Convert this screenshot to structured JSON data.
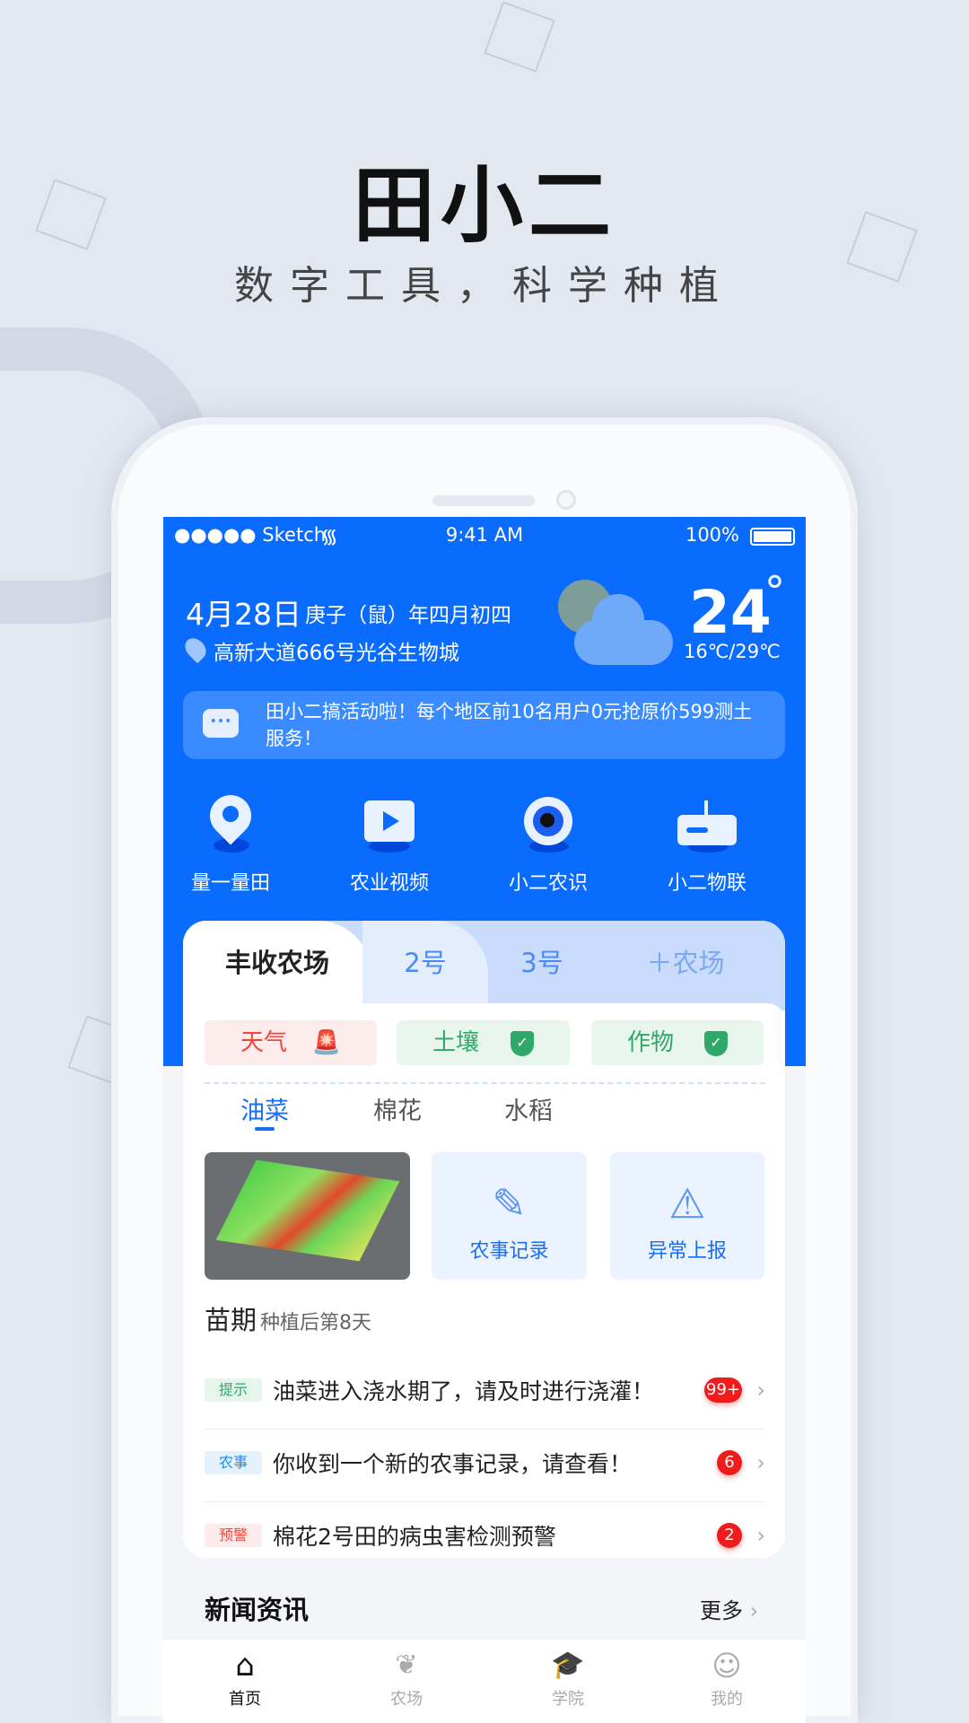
{
  "promo": {
    "title": "田小二",
    "subtitle": "数字工具，科学种植"
  },
  "status_bar": {
    "carrier": "●●●●● Sketch",
    "time": "9:41 AM",
    "battery": "100%"
  },
  "header": {
    "date": "4月28日",
    "lunar": "庚子（鼠）年四月初四",
    "address": "高新大道666号光谷生物城",
    "temperature": "24",
    "degree": "°",
    "range": "16℃/29℃",
    "weather_icon": "partly-cloudy-icon"
  },
  "notice": {
    "text": "田小二搞活动啦！每个地区前10名用户0元抢原价599测土服务！"
  },
  "quick_actions": [
    {
      "label": "量一量田",
      "icon": "location-pin-icon"
    },
    {
      "label": "农业视频",
      "icon": "video-play-icon"
    },
    {
      "label": "小二农识",
      "icon": "eye-icon"
    },
    {
      "label": "小二物联",
      "icon": "router-icon"
    }
  ],
  "farm_tabs": [
    {
      "label": "丰收农场",
      "active": true
    },
    {
      "label": "2号"
    },
    {
      "label": "3号"
    },
    {
      "label": "＋农场"
    }
  ],
  "chips": [
    {
      "label": "天气",
      "icon": "alarm-light-icon",
      "color": "#f0453a"
    },
    {
      "label": "土壤",
      "icon": "shield-check-icon",
      "color": "#2fa86a"
    },
    {
      "label": "作物",
      "icon": "shield-check-icon",
      "color": "#2fa86a"
    }
  ],
  "crop_tabs": [
    {
      "label": "油菜",
      "active": true
    },
    {
      "label": "棉花"
    },
    {
      "label": "水稻"
    }
  ],
  "tiles": [
    {
      "label": "农事记录",
      "icon": "pencil-icon"
    },
    {
      "label": "异常上报",
      "icon": "warning-icon"
    }
  ],
  "stage": {
    "name": "苗期",
    "detail": "种植后第8天"
  },
  "messages": [
    {
      "tag": "提示",
      "text": "油菜进入浇水期了，请及时进行浇灌！",
      "count": "99+",
      "tag_color": "#2fa86a",
      "tag_bg": "#e6f6ec"
    },
    {
      "tag": "农事",
      "text": "你收到一个新的农事记录，请查看！",
      "count": "6",
      "tag_color": "#1a8cf0",
      "tag_bg": "#e3f2fd"
    },
    {
      "tag": "预警",
      "text": "棉花2号田的病虫害检测预警",
      "count": "2",
      "tag_color": "#f0453a",
      "tag_bg": "#fdeceb"
    }
  ],
  "news": {
    "title": "新闻资讯",
    "more": "更多"
  },
  "tabbar": [
    {
      "label": "首页",
      "icon": "home-icon",
      "active": true
    },
    {
      "label": "农场",
      "icon": "sprout-icon"
    },
    {
      "label": "学院",
      "icon": "graduation-cap-icon"
    },
    {
      "label": "我的",
      "icon": "smiley-user-icon"
    }
  ],
  "colors": {
    "primary": "#0a6cff",
    "badge": "#f01b1b"
  }
}
